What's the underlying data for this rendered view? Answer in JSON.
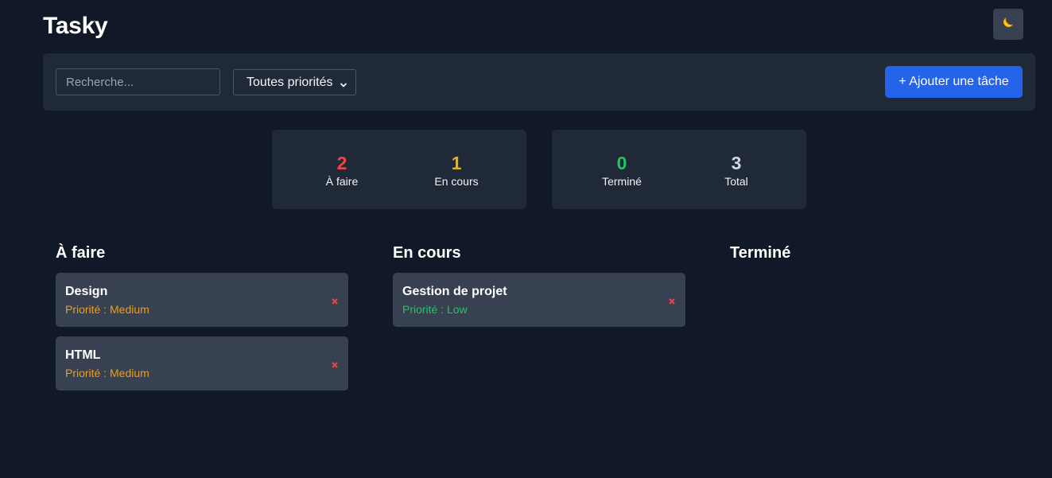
{
  "app": {
    "title": "Tasky"
  },
  "header": {
    "theme_icon": "moon-icon"
  },
  "toolbar": {
    "search_placeholder": "Recherche...",
    "search_value": "",
    "priority_selected": "Toutes priorités",
    "add_label": "+ Ajouter une tâche"
  },
  "stats": {
    "todo": {
      "value": "2",
      "label": "À faire",
      "color": "#ef4444"
    },
    "in_progress": {
      "value": "1",
      "label": "En cours",
      "color": "#eab308"
    },
    "done": {
      "value": "0",
      "label": "Terminé",
      "color": "#22c55e"
    },
    "total": {
      "value": "3",
      "label": "Total",
      "color": "#d1d5db"
    }
  },
  "columns": [
    {
      "title": "À faire",
      "tasks": [
        {
          "name": "Design",
          "priority": "Priorité : Medium",
          "priority_color": "#f59e0b"
        },
        {
          "name": "HTML",
          "priority": "Priorité : Medium",
          "priority_color": "#f59e0b"
        }
      ]
    },
    {
      "title": "En cours",
      "tasks": [
        {
          "name": "Gestion de projet",
          "priority": "Priorité : Low",
          "priority_color": "#22c55e"
        }
      ]
    },
    {
      "title": "Terminé",
      "tasks": []
    }
  ],
  "colors": {
    "background": "#111827",
    "panel": "#1f2937",
    "card": "#374151",
    "accent": "#2563eb",
    "delete": "#ef4444"
  }
}
